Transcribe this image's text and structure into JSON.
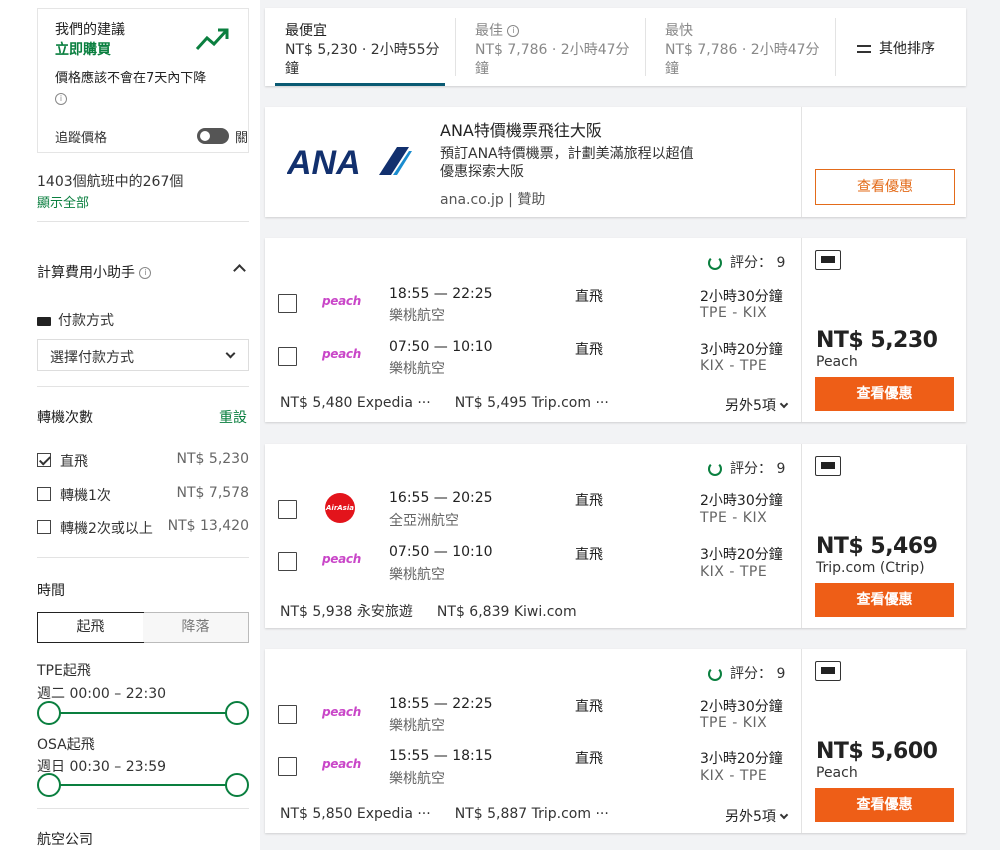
{
  "sidebar": {
    "advice": {
      "title": "我們的建議",
      "action": "立即購買",
      "desc": "價格應該不會在7天內下降",
      "track_label": "追蹤價格",
      "toggle_state": "關"
    },
    "result_count": "1403個航班中的267個",
    "show_all": "顯示全部",
    "fee_helper": "計算費用小助手",
    "payment": {
      "label": "付款方式",
      "select_placeholder": "選擇付款方式"
    },
    "stops": {
      "title": "轉機次數",
      "reset": "重設",
      "options": [
        {
          "label": "直飛",
          "price": "NT$ 5,230",
          "checked": true
        },
        {
          "label": "轉機1次",
          "price": "NT$ 7,578",
          "checked": false
        },
        {
          "label": "轉機2次或以上",
          "price": "NT$ 13,420",
          "checked": false
        }
      ]
    },
    "time": {
      "title": "時間",
      "tabs": [
        "起飛",
        "降落"
      ],
      "depart1": {
        "title": "TPE起飛",
        "range": "週二 00:00 – 22:30"
      },
      "depart2": {
        "title": "OSA起飛",
        "range": "週日 00:30 – 23:59"
      }
    },
    "airlines_title": "航空公司"
  },
  "sort": [
    {
      "label": "最便宜",
      "value": "NT$ 5,230 · 2小時55分鐘",
      "active": true
    },
    {
      "label": "最佳",
      "value": "NT$ 7,786 · 2小時47分鐘",
      "active": false
    },
    {
      "label": "最快",
      "value": "NT$ 7,786 · 2小時47分鐘",
      "active": false
    }
  ],
  "other_sort": "其他排序",
  "ad": {
    "logo": "ANA",
    "title": "ANA特價機票飛往大阪",
    "desc": "預訂ANA特價機票，計劃美滿旅程以超值優惠探索大阪",
    "source": "ana.co.jp | 贊助",
    "button": "查看優惠"
  },
  "results": [
    {
      "score": "評分： 9",
      "legs": [
        {
          "logo": "peach",
          "time": "18:55 — 22:25",
          "airline": "樂桃航空",
          "stops": "直飛",
          "duration": "2小時30分鐘",
          "route": "TPE - KIX"
        },
        {
          "logo": "peach",
          "time": "07:50 — 10:10",
          "airline": "樂桃航空",
          "stops": "直飛",
          "duration": "3小時20分鐘",
          "route": "KIX - TPE"
        }
      ],
      "alt1": "NT$ 5,480 Expedia ···",
      "alt2": "NT$ 5,495 Trip.com ···",
      "more": "另外5項",
      "price": "NT$ 5,230",
      "vendor": "Peach",
      "button": "查看優惠"
    },
    {
      "score": "評分： 9",
      "legs": [
        {
          "logo": "AirAsia",
          "time": "16:55 — 20:25",
          "airline": "全亞洲航空",
          "stops": "直飛",
          "duration": "2小時30分鐘",
          "route": "TPE - KIX"
        },
        {
          "logo": "peach",
          "time": "07:50 — 10:10",
          "airline": "樂桃航空",
          "stops": "直飛",
          "duration": "3小時20分鐘",
          "route": "KIX - TPE"
        }
      ],
      "alt1": "NT$ 5,938 永安旅遊",
      "alt2": "NT$ 6,839 Kiwi.com",
      "more": "",
      "price": "NT$ 5,469",
      "vendor": "Trip.com (Ctrip)",
      "button": "查看優惠"
    },
    {
      "score": "評分： 9",
      "legs": [
        {
          "logo": "peach",
          "time": "18:55 — 22:25",
          "airline": "樂桃航空",
          "stops": "直飛",
          "duration": "2小時30分鐘",
          "route": "TPE - KIX"
        },
        {
          "logo": "peach",
          "time": "15:55 — 18:15",
          "airline": "樂桃航空",
          "stops": "直飛",
          "duration": "3小時20分鐘",
          "route": "KIX - TPE"
        }
      ],
      "alt1": "NT$ 5,850 Expedia ···",
      "alt2": "NT$ 5,887 Trip.com ···",
      "more": "另外5項",
      "price": "NT$ 5,600",
      "vendor": "Peach",
      "button": "查看優惠"
    }
  ]
}
